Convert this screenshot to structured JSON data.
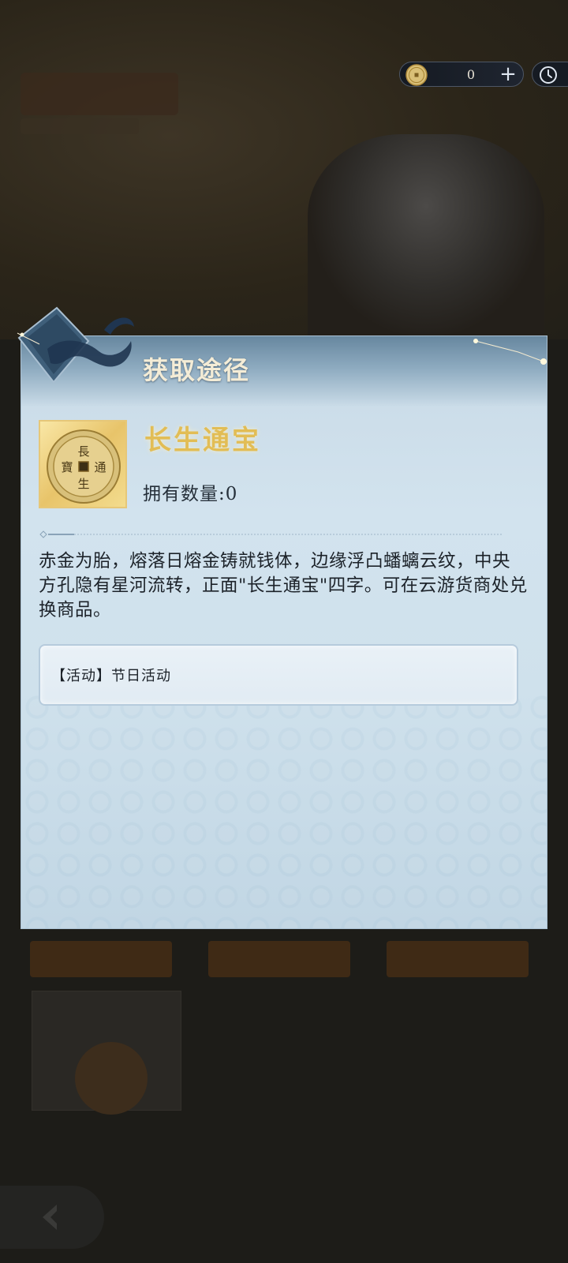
{
  "currency": {
    "icon": "coin-icon",
    "value": "0",
    "add_label": "+"
  },
  "dialog": {
    "title": "获取途径",
    "item": {
      "name": "长生通宝",
      "count_label": "拥有数量:",
      "count_value": "0",
      "coin_inscription": [
        "長",
        "通",
        "生",
        "寶"
      ]
    },
    "description": "赤金为胎，熔落日熔金铸就钱体，边缘浮凸蟠螭云纹，中央方孔隐有星河流转，正面\"长生通宝\"四字。可在云游货商处兑换商品。",
    "source": "【活动】节日活动"
  },
  "colors": {
    "dialog_bg": "#cfe1ec",
    "item_name": "#e2bd55",
    "header": "#67879f"
  }
}
